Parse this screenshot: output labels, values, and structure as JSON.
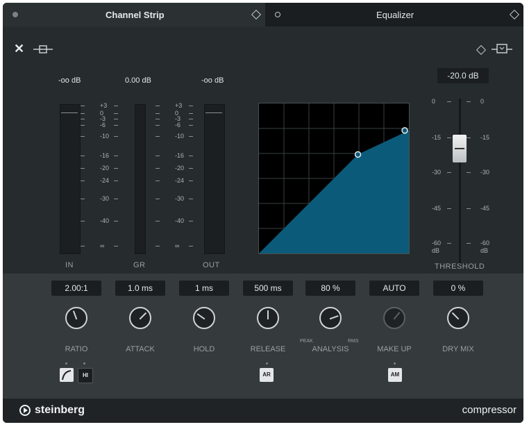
{
  "tabs": [
    {
      "label": "Channel Strip",
      "active": true
    },
    {
      "label": "Equalizer",
      "active": false
    }
  ],
  "icons": {
    "close": "close-icon",
    "bypass": "bypass-icon",
    "preset": "preset-icon",
    "routing": "routing-icon",
    "tab_preset": "preset-diamond-icon",
    "tab_dot": "tab-indicator-icon"
  },
  "meters": {
    "in": {
      "label": "IN",
      "value": "-oo dB"
    },
    "gr": {
      "label": "GR",
      "value": "0.00 dB"
    },
    "out": {
      "label": "OUT",
      "value": "-oo dB"
    },
    "scale": [
      "+3",
      "0",
      "-3",
      "-6",
      "-10",
      "-16",
      "-20",
      "-24",
      "-30",
      "-40",
      "∞"
    ]
  },
  "threshold": {
    "label": "THRESHOLD",
    "value": "-20.0 dB",
    "level_db": -20,
    "scale_left": [
      "0",
      "-15",
      "-30",
      "-45",
      "-60"
    ],
    "scale_right": [
      "0",
      "-15",
      "-30",
      "-45",
      "-60"
    ],
    "unit": "dB"
  },
  "graph": {
    "fill_color": "#0b5a7a",
    "grid_divisions": 6,
    "curve": [
      [
        0,
        0
      ],
      [
        0.66,
        0.66
      ],
      [
        1,
        0.82
      ]
    ],
    "nodes": [
      [
        0.66,
        0.66
      ],
      [
        1,
        0.82
      ]
    ]
  },
  "controls": [
    {
      "name": "ratio",
      "label": "RATIO",
      "value": "2.00:1",
      "angle": -20,
      "active": true
    },
    {
      "name": "attack",
      "label": "ATTACK",
      "value": "1.0 ms",
      "angle": 45,
      "active": true
    },
    {
      "name": "hold",
      "label": "HOLD",
      "value": "1 ms",
      "angle": -55,
      "active": true
    },
    {
      "name": "release",
      "label": "RELEASE",
      "value": "500 ms",
      "angle": 0,
      "active": true
    },
    {
      "name": "analysis",
      "label": "ANALYSIS",
      "value": "80 %",
      "angle": 70,
      "active": true
    },
    {
      "name": "make-up",
      "label": "MAKE UP",
      "value": "AUTO",
      "angle": 40,
      "active": false
    },
    {
      "name": "dry-mix",
      "label": "DRY MIX",
      "value": "0 %",
      "angle": -45,
      "active": true
    }
  ],
  "analysis_range": {
    "left": "PEAK",
    "right": "RMS"
  },
  "buttons": {
    "soft_knee": "soft-knee-icon",
    "hi": "HI",
    "ar": "AR",
    "am": "AM"
  },
  "footer": {
    "brand": "steinberg",
    "product": "compressor"
  }
}
